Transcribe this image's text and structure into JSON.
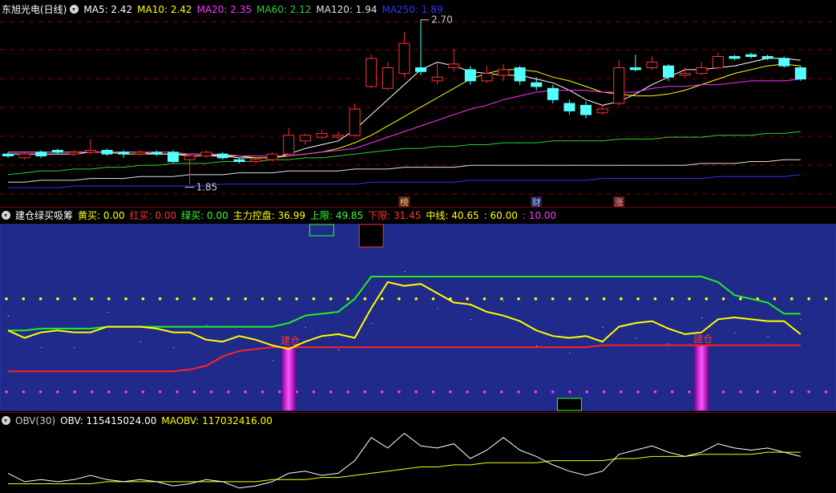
{
  "main": {
    "title": "东旭光电(日线)",
    "ma": [
      {
        "label": "MA5: 2.42",
        "color": "#ffffff"
      },
      {
        "label": "MA10: 2.42",
        "color": "#ffff00"
      },
      {
        "label": "MA20: 2.35",
        "color": "#ff33ff"
      },
      {
        "label": "MA60: 2.12",
        "color": "#33cc33"
      },
      {
        "label": "MA120: 1.94",
        "color": "#e0e0e0"
      },
      {
        "label": "MA250: 1.89",
        "color": "#3333ff"
      }
    ],
    "high_label": "2.70",
    "low_label": "1.85",
    "price_range": [
      1.78,
      2.78
    ],
    "markers": [
      {
        "label": "榜",
        "color": "#ffcc66",
        "bg": "#552222",
        "index": 24
      },
      {
        "label": "财",
        "color": "#aaccff",
        "bg": "#222255",
        "index": 32
      },
      {
        "label": "涨",
        "color": "#ff9999",
        "bg": "#552222",
        "index": 37
      }
    ],
    "candles": [
      [
        2.01,
        2.0,
        2.02,
        1.99
      ],
      [
        1.99,
        2.01,
        2.02,
        1.98
      ],
      [
        2.02,
        2.0,
        2.03,
        1.99
      ],
      [
        2.03,
        2.02,
        2.04,
        2.01
      ],
      [
        2.01,
        2.02,
        2.03,
        2.0
      ],
      [
        2.02,
        2.03,
        2.09,
        2.01
      ],
      [
        2.03,
        2.01,
        2.04,
        2.0
      ],
      [
        2.02,
        2.01,
        2.03,
        1.99
      ],
      [
        2.01,
        2.02,
        2.03,
        2.0
      ],
      [
        2.02,
        2.01,
        2.03,
        2.0
      ],
      [
        2.02,
        1.97,
        2.03,
        1.96
      ],
      [
        1.98,
        2.0,
        2.01,
        1.85
      ],
      [
        2.0,
        2.02,
        2.03,
        1.99
      ],
      [
        2.01,
        1.99,
        2.02,
        1.98
      ],
      [
        1.98,
        1.97,
        1.99,
        1.96
      ],
      [
        1.97,
        1.98,
        1.99,
        1.96
      ],
      [
        1.98,
        2.01,
        2.02,
        1.97
      ],
      [
        2.01,
        2.11,
        2.15,
        2.0
      ],
      [
        2.08,
        2.11,
        2.12,
        2.06
      ],
      [
        2.1,
        2.12,
        2.14,
        2.09
      ],
      [
        2.1,
        2.11,
        2.13,
        2.09
      ],
      [
        2.11,
        2.25,
        2.28,
        2.1
      ],
      [
        2.37,
        2.52,
        2.54,
        2.36
      ],
      [
        2.36,
        2.47,
        2.5,
        2.35
      ],
      [
        2.44,
        2.6,
        2.66,
        2.42
      ],
      [
        2.47,
        2.45,
        2.7,
        2.43
      ],
      [
        2.4,
        2.42,
        2.5,
        2.38
      ],
      [
        2.47,
        2.49,
        2.57,
        2.45
      ],
      [
        2.46,
        2.4,
        2.48,
        2.38
      ],
      [
        2.4,
        2.44,
        2.48,
        2.39
      ],
      [
        2.43,
        2.46,
        2.49,
        2.4
      ],
      [
        2.47,
        2.4,
        2.48,
        2.38
      ],
      [
        2.39,
        2.37,
        2.42,
        2.35
      ],
      [
        2.36,
        2.3,
        2.38,
        2.28
      ],
      [
        2.28,
        2.24,
        2.3,
        2.22
      ],
      [
        2.27,
        2.22,
        2.29,
        2.2
      ],
      [
        2.23,
        2.25,
        2.27,
        2.22
      ],
      [
        2.28,
        2.47,
        2.51,
        2.27
      ],
      [
        2.47,
        2.46,
        2.54,
        2.45
      ],
      [
        2.47,
        2.5,
        2.53,
        2.46
      ],
      [
        2.48,
        2.42,
        2.49,
        2.4
      ],
      [
        2.43,
        2.44,
        2.47,
        2.42
      ],
      [
        2.44,
        2.47,
        2.5,
        2.43
      ],
      [
        2.47,
        2.53,
        2.55,
        2.46
      ],
      [
        2.53,
        2.52,
        2.54,
        2.51
      ],
      [
        2.54,
        2.53,
        2.55,
        2.52
      ],
      [
        2.53,
        2.52,
        2.54,
        2.51
      ],
      [
        2.52,
        2.48,
        2.53,
        2.47
      ],
      [
        2.47,
        2.41,
        2.48,
        2.4
      ]
    ],
    "ma_lines": [
      {
        "color": "#ffffff",
        "values": [
          2.01,
          2.01,
          2.01,
          2.01,
          2.01,
          2.02,
          2.02,
          2.02,
          2.02,
          2.01,
          2.01,
          2.0,
          2.0,
          2.0,
          1.99,
          1.99,
          1.99,
          2.01,
          2.04,
          2.06,
          2.08,
          2.14,
          2.22,
          2.3,
          2.38,
          2.46,
          2.5,
          2.48,
          2.45,
          2.44,
          2.43,
          2.43,
          2.41,
          2.39,
          2.35,
          2.3,
          2.27,
          2.29,
          2.33,
          2.38,
          2.42,
          2.46,
          2.46,
          2.47,
          2.48,
          2.5,
          2.52,
          2.52,
          2.51
        ]
      },
      {
        "color": "#ffff00",
        "values": [
          2.02,
          2.02,
          2.02,
          2.02,
          2.02,
          2.02,
          2.02,
          2.01,
          2.01,
          2.01,
          2.01,
          2.01,
          2.01,
          2.0,
          2.0,
          1.99,
          1.99,
          2.0,
          2.01,
          2.02,
          2.04,
          2.07,
          2.11,
          2.16,
          2.21,
          2.26,
          2.31,
          2.36,
          2.41,
          2.44,
          2.46,
          2.46,
          2.45,
          2.42,
          2.4,
          2.37,
          2.34,
          2.33,
          2.32,
          2.32,
          2.33,
          2.35,
          2.38,
          2.41,
          2.44,
          2.46,
          2.48,
          2.49,
          2.48
        ]
      },
      {
        "color": "#ff33ff",
        "values": [
          2.02,
          2.02,
          2.02,
          2.02,
          2.02,
          2.02,
          2.02,
          2.02,
          2.02,
          2.02,
          2.02,
          2.01,
          2.01,
          2.01,
          2.0,
          2.0,
          2.0,
          2.0,
          2.01,
          2.02,
          2.03,
          2.04,
          2.07,
          2.1,
          2.13,
          2.16,
          2.19,
          2.22,
          2.25,
          2.27,
          2.3,
          2.32,
          2.34,
          2.35,
          2.35,
          2.35,
          2.34,
          2.34,
          2.34,
          2.36,
          2.37,
          2.37,
          2.38,
          2.38,
          2.39,
          2.4,
          2.4,
          2.4,
          2.41
        ]
      },
      {
        "color": "#33cc33",
        "values": [
          1.9,
          1.91,
          1.92,
          1.92,
          1.93,
          1.93,
          1.94,
          1.94,
          1.95,
          1.95,
          1.96,
          1.96,
          1.96,
          1.97,
          1.97,
          1.97,
          1.98,
          1.98,
          1.99,
          1.99,
          2.0,
          2.01,
          2.02,
          2.03,
          2.04,
          2.04,
          2.05,
          2.05,
          2.06,
          2.06,
          2.07,
          2.07,
          2.07,
          2.08,
          2.08,
          2.08,
          2.08,
          2.09,
          2.09,
          2.09,
          2.1,
          2.1,
          2.1,
          2.11,
          2.11,
          2.11,
          2.12,
          2.12,
          2.13
        ]
      },
      {
        "color": "#e0e0e0",
        "values": [
          1.86,
          1.86,
          1.87,
          1.87,
          1.87,
          1.88,
          1.88,
          1.88,
          1.89,
          1.89,
          1.89,
          1.9,
          1.9,
          1.9,
          1.91,
          1.91,
          1.91,
          1.92,
          1.92,
          1.92,
          1.92,
          1.93,
          1.93,
          1.93,
          1.94,
          1.94,
          1.94,
          1.94,
          1.95,
          1.95,
          1.95,
          1.95,
          1.95,
          1.95,
          1.95,
          1.95,
          1.95,
          1.95,
          1.95,
          1.95,
          1.95,
          1.95,
          1.96,
          1.96,
          1.96,
          1.97,
          1.97,
          1.98,
          1.98
        ]
      },
      {
        "color": "#3333ff",
        "values": [
          1.83,
          1.83,
          1.83,
          1.83,
          1.84,
          1.84,
          1.84,
          1.84,
          1.84,
          1.84,
          1.84,
          1.84,
          1.84,
          1.85,
          1.85,
          1.85,
          1.85,
          1.85,
          1.85,
          1.85,
          1.85,
          1.85,
          1.86,
          1.86,
          1.86,
          1.86,
          1.86,
          1.86,
          1.87,
          1.87,
          1.87,
          1.87,
          1.87,
          1.87,
          1.87,
          1.87,
          1.88,
          1.88,
          1.88,
          1.88,
          1.88,
          1.88,
          1.88,
          1.89,
          1.89,
          1.89,
          1.89,
          1.89,
          1.9
        ]
      }
    ]
  },
  "indicator": {
    "title": "建仓绿买吸筹",
    "fields": [
      {
        "label": "黄买: 0.00",
        "color": "#ffff00"
      },
      {
        "label": "红买: 0.00",
        "color": "#ff3333"
      },
      {
        "label": "绿买: 0.00",
        "color": "#33ff33"
      },
      {
        "label": "主力控盘: 36.99",
        "color": "#ffff00"
      },
      {
        "label": "上限: 49.85",
        "color": "#33ff33"
      },
      {
        "label": "下限: 31.45",
        "color": "#ff3333"
      },
      {
        "label": "中线: 40.65",
        "color": "#ffff00"
      },
      {
        "label": ": 60.00",
        "color": "#ffff00"
      },
      {
        "label": ": 10.00",
        "color": "#ff33ff"
      }
    ],
    "range": [
      0,
      100
    ],
    "level_high": 60,
    "level_low": 10,
    "buy_label": "建仓",
    "buy_indices": [
      17,
      42
    ],
    "green_box_indices": [
      19,
      34
    ],
    "red_box_index": 22,
    "control": [
      43,
      39,
      42,
      43,
      42,
      42,
      45,
      45,
      45,
      44,
      42,
      42,
      38,
      37,
      40,
      38,
      35,
      33,
      37,
      40,
      41,
      39,
      55,
      69,
      67,
      68,
      63,
      58,
      57,
      53,
      51,
      48,
      43,
      40,
      39,
      40,
      37,
      45,
      47,
      48,
      44,
      41,
      42,
      49,
      50,
      49,
      48,
      48,
      41
    ],
    "upper": [
      43,
      43,
      44,
      44,
      44,
      44,
      45,
      45,
      45,
      45,
      45,
      45,
      45,
      45,
      45,
      45,
      45,
      47,
      51,
      52,
      53,
      60,
      72,
      72,
      72,
      72,
      72,
      72,
      72,
      72,
      72,
      72,
      72,
      72,
      72,
      72,
      72,
      72,
      72,
      72,
      72,
      72,
      72,
      69,
      62,
      60,
      58,
      52,
      52
    ],
    "lower": [
      21,
      21,
      21,
      21,
      21,
      21,
      21,
      21,
      21,
      21,
      21,
      22,
      24,
      29,
      32,
      33,
      34,
      34,
      34,
      34,
      34,
      34,
      34,
      34,
      34,
      34,
      34,
      34,
      34,
      34,
      34,
      34,
      34,
      34,
      34,
      34,
      35,
      35,
      35,
      35,
      35,
      35,
      35,
      35,
      35,
      35,
      35,
      35,
      35
    ]
  },
  "obv": {
    "title": "OBV(30)",
    "obv_label": "OBV: 115415024.00",
    "maobv_label": "MAOBV: 117032416.00",
    "obv_color": "#ffffff",
    "maobv_color": "#ffff00",
    "obv": [
      107,
      103,
      104,
      103,
      104,
      106,
      104,
      103,
      104,
      103,
      101,
      102,
      104,
      103,
      100,
      101,
      103,
      107,
      108,
      106,
      107,
      113,
      124,
      119,
      126,
      120,
      119,
      121,
      114,
      118,
      124,
      118,
      115,
      111,
      108,
      106,
      108,
      116,
      118,
      120,
      117,
      115,
      117,
      121,
      119,
      118,
      119,
      117,
      115
    ],
    "maobv": [
      102,
      102,
      102,
      102,
      102,
      102,
      103,
      103,
      103,
      103,
      103,
      103,
      103,
      103,
      103,
      103,
      104,
      104,
      104,
      105,
      105,
      106,
      107,
      108,
      109,
      110,
      110,
      111,
      111,
      112,
      112,
      112,
      112,
      113,
      113,
      113,
      113,
      114,
      114,
      115,
      115,
      115,
      116,
      116,
      116,
      116,
      117,
      117,
      117
    ],
    "range": [
      98,
      130
    ]
  }
}
